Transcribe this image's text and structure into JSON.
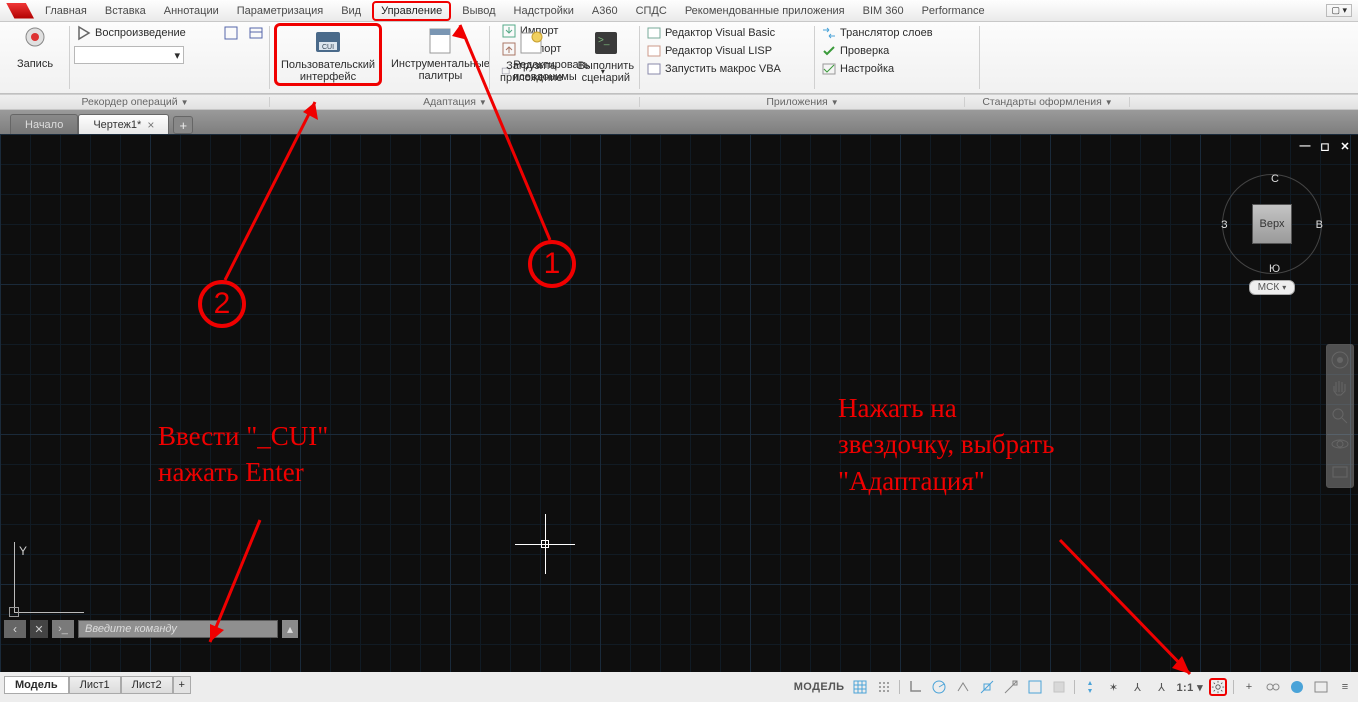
{
  "menu": {
    "items": [
      "Главная",
      "Вставка",
      "Аннотации",
      "Параметризация",
      "Вид",
      "Управление",
      "Вывод",
      "Надстройки",
      "A360",
      "СПДС",
      "Рекомендованные приложения",
      "BIM 360",
      "Performance"
    ],
    "highlighted_index": 5
  },
  "ribbon": {
    "recorder": {
      "title": "Рекордер операций",
      "record_label": "Запись",
      "play_label": "Воспроизведение"
    },
    "cui": {
      "button": "Пользовательский\nинтерфейс",
      "palettes": "Инструментальные\nпалитры",
      "import": "Импорт",
      "export": "Экспорт",
      "alias": "Редактировать псевдонимы",
      "title": "Адаптация"
    },
    "apps": {
      "load": "Загрузить\nприложение",
      "run": "Выполнить\nсценарий",
      "vbe": "Редактор Visual Basic",
      "vle": "Редактор Visual LISP",
      "vba": "Запустить макрос VBA",
      "translator": "Транслятор слоев",
      "check": "Проверка",
      "settings": "Настройка",
      "title": "Приложения",
      "std_title": "Стандарты оформления"
    }
  },
  "file_tabs": {
    "home": "Начало",
    "active": "Чертеж1*"
  },
  "viewcube": {
    "face": "Верх",
    "n": "С",
    "s": "Ю",
    "e": "В",
    "w": "З",
    "msk": "МСК"
  },
  "sheets": {
    "model": "Модель",
    "l1": "Лист1",
    "l2": "Лист2"
  },
  "cmdline": {
    "placeholder": "Введите команду"
  },
  "status": {
    "model": "МОДЕЛЬ",
    "scale": "1:1"
  },
  "annotations": {
    "one": "1",
    "two": "2",
    "cui_hint": "Ввести \"_CUI\"\nнажать Enter",
    "gear_hint": "Нажать на\nзвездочку, выбрать\n\"Адаптация\""
  }
}
